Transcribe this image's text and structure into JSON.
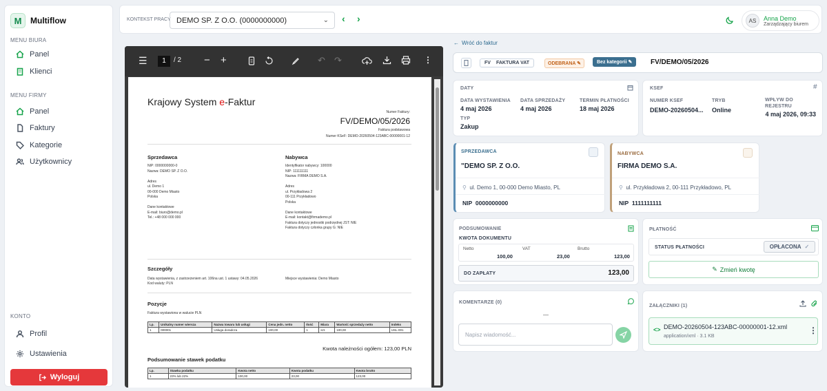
{
  "app": {
    "name": "Multiflow",
    "logo_letter": "M"
  },
  "sidebar": {
    "section_office": "MENU BIURA",
    "office_items": [
      {
        "label": "Panel",
        "icon": "home-icon"
      },
      {
        "label": "Klienci",
        "icon": "building-icon"
      }
    ],
    "section_company": "MENU FIRMY",
    "company_items": [
      {
        "label": "Panel",
        "icon": "home-icon"
      },
      {
        "label": "Faktury",
        "icon": "file-icon"
      },
      {
        "label": "Kategorie",
        "icon": "tag-icon"
      },
      {
        "label": "Użytkownicy",
        "icon": "users-icon"
      }
    ],
    "section_account": "KONTO",
    "account_items": [
      {
        "label": "Profil",
        "icon": "user-icon"
      },
      {
        "label": "Ustawienia",
        "icon": "gear-icon"
      }
    ],
    "logout_label": "Wyloguj"
  },
  "topbar": {
    "context_label": "KONTEKST PRACY",
    "context_value": "DEMO SP. Z O.O. (0000000000)",
    "user_initials": "AS",
    "user_name": "Anna Demo",
    "user_role": "Zarządzający biurem"
  },
  "viewer": {
    "page_current": "1",
    "page_total": "/ 2"
  },
  "pdf": {
    "brand_prefix": "Krajowy System ",
    "brand_e": "e",
    "brand_suffix": "-Faktur",
    "invoice_no_label": "Numer Faktury:",
    "invoice_no": "FV/DEMO/05/2026",
    "invoice_kind": "Faktura podstawowa",
    "ksef_line": "Numer KSeF: DEMO-20260504-123ABC-00000001-12",
    "seller_title": "Sprzedawca",
    "seller_lines": [
      "NIP: 0000000000-0",
      "Nazwa: DEMO SP. Z O.O.",
      "",
      "Adres",
      "ul. Demo 1",
      "00-000 Demo Miasto",
      "Polska",
      "",
      "Dane kontaktowe",
      "E-mail: biuro@demo.pl",
      "Tel.: +48 000 000 000"
    ],
    "buyer_title": "Nabywca",
    "buyer_lines": [
      "Identyfikator nabywcy: 100000",
      "NIP: 111111111",
      "Nazwa: FIRMA DEMO S.A.",
      "",
      "Adres",
      "ul. Przykładowa 2",
      "00-111 Przykładowo",
      "Polska",
      "",
      "Dane kontaktowe",
      "E-mail: kontakt@firmademo.pl",
      "Faktura dotyczy jednostki podrzędnej JST: NIE",
      "Faktura dotyczy członka grupy G: NIE"
    ],
    "details_title": "Szczegóły",
    "details_left": "Data wystawienia, z zastrzeżeniem art. 106na ust. 1 ustawy: 04.05.2026",
    "details_left2": "Kod waluty: PLN",
    "details_right": "Miejsce wystawienia: Demo Miasto",
    "positions_title": "Pozycje",
    "positions_note": "Faktura wystawiona w walucie PLN",
    "positions_headers": [
      "Lp.",
      "Unikalny numer wiersza",
      "Nazwa towaru lub usługi",
      "Cena jedn. netto",
      "Ilość",
      "Miara",
      "Wartość sprzedaży netto",
      "Indeks"
    ],
    "positions_rows": [
      [
        "1",
        "000001",
        "Usługa doradcza",
        "100,00",
        "1",
        "szt.",
        "100,00",
        "USL-001"
      ]
    ],
    "total_due": "Kwota należności ogółem: 123,00 PLN",
    "tax_title": "Podsumowanie stawek podatku",
    "tax_headers": [
      "Lp.",
      "Stawka podatku",
      "Kwota netto",
      "Kwota podatku",
      "Kwota brutto"
    ],
    "tax_rows": [
      [
        "1",
        "23% lub 22%",
        "100,00",
        "23,00",
        "123,00"
      ]
    ]
  },
  "detail": {
    "back_label": "Wróć do faktur",
    "type_short": "FV",
    "type_label": "FAKTURA VAT",
    "status": "ODEBRANA",
    "category": "Bez kategorii",
    "number": "FV/DEMO/05/2026",
    "dates": {
      "title": "DATY",
      "issue_label": "DATA WYSTAWIENIA",
      "issue": "4 maj 2026",
      "sale_label": "DATA SPRZEDAŻY",
      "sale": "4 maj 2026",
      "due_label": "TERMIN PŁATNOŚCI",
      "due": "18 maj 2026",
      "type_label": "TYP",
      "type": "Zakup"
    },
    "ksef": {
      "title": "KSEF",
      "num_label": "NUMER KSEF",
      "num": "DEMO-20260504...",
      "mode_label": "TRYB",
      "mode": "Online",
      "in_label": "WPŁYW DO REJESTRU",
      "in": "4 maj 2026, 09:33"
    },
    "seller": {
      "title": "SPRZEDAWCA",
      "name": "\"DEMO SP. Z O.O.",
      "address": "ul. Demo 1, 00-000 Demo Miasto, PL",
      "nip_label": "NIP",
      "nip": "0000000000"
    },
    "buyer": {
      "title": "NABYWCA",
      "name": "FIRMA DEMO S.A.",
      "address": "ul. Przykładowa 2, 00-111 Przykładowo, PL",
      "nip_label": "NIP",
      "nip": "1111111111"
    },
    "summary": {
      "title": "PODSUMOWANIE",
      "doc_label": "KWOTA DOKUMENTU",
      "net_label": "Netto",
      "net": "100,00",
      "vat_label": "VAT",
      "vat": "23,00",
      "gross_label": "Brutto",
      "gross": "123,00",
      "pay_label": "DO ZAPŁATY",
      "pay": "123,00"
    },
    "payment": {
      "title": "PŁATNOŚĆ",
      "status_label": "STATUS PŁATNOŚCI",
      "status": "OPŁACONA",
      "change_label": "Zmień kwotę"
    },
    "comments": {
      "title": "KOMENTARZE (0)",
      "empty": "—",
      "placeholder": "Napisz wiadomość..."
    },
    "attachments": {
      "title": "ZAŁĄCZNIKI (1)",
      "file": "DEMO-20260504-123ABC-00000001-12.xml",
      "meta": "application/xml · 3.1 KB"
    }
  },
  "colors": {
    "accent": "#16a34a",
    "danger": "#e5383b",
    "category": "#3b6f8f"
  }
}
